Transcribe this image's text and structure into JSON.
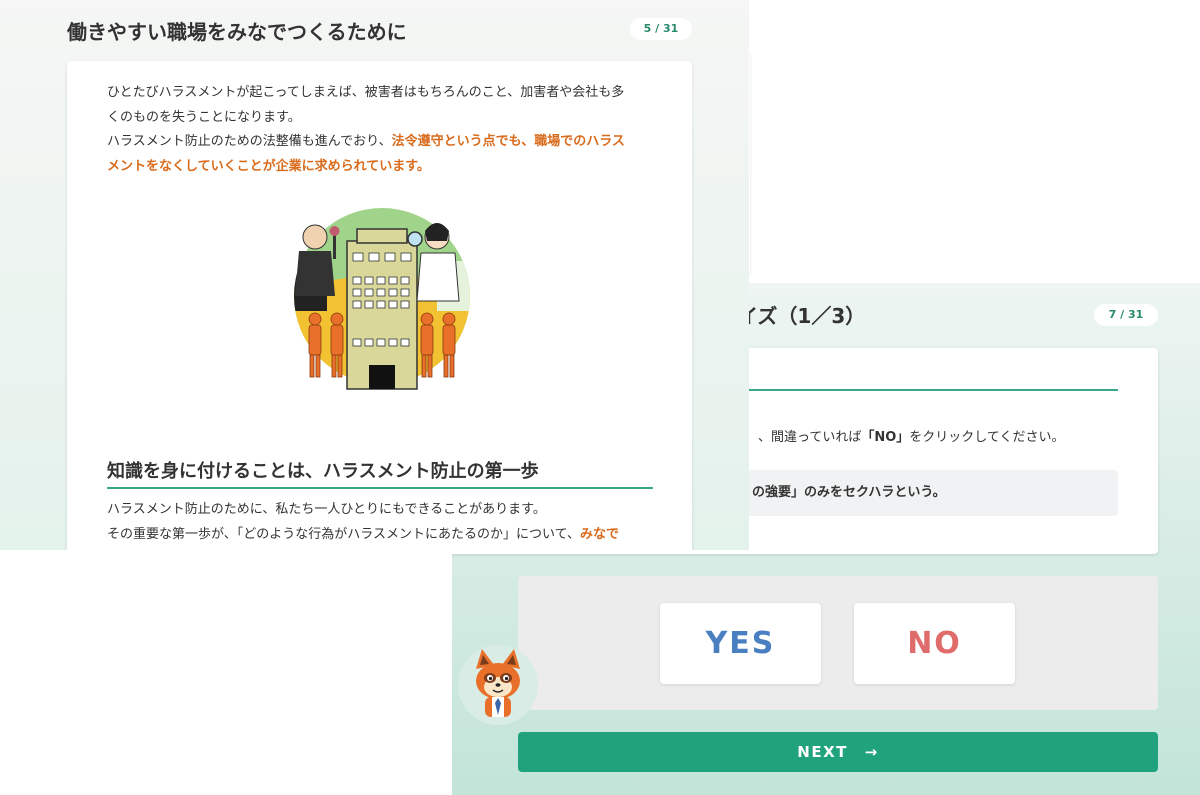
{
  "lesson": {
    "title": "働きやすい職場をみなでつくるために",
    "page": "5 / 31",
    "para1_line1": "ひとたびハラスメントが起こってしまえば、被害者はもちろんのこと、加害者や会社も多",
    "para1_line2": "くのものを失うことになります。",
    "para2_plain": "ハラスメント防止のための法整備も進んでおり、",
    "para2_highlight_a": "法令遵守という点でも、職場でのハラス",
    "para2_highlight_b": "メントをなくしていくことが企業に求められています。",
    "section_title": "知識を身に付けることは、ハラスメント防止の第一歩",
    "para3_line1": "ハラスメント防止のために、私たち一人ひとりにもできることがあります。",
    "para3_line2_plain": "その重要な第一歩が、「どのような行為がハラスメントにあたるのか」について、",
    "para3_line2_highlight": "みなで"
  },
  "quiz": {
    "title_partial": "イズ（1／3）",
    "page": "7 / 31",
    "instruction_a": "、間違っていれば",
    "instruction_no": "「NO」",
    "instruction_b": "をクリックしてください。",
    "statement_partial": "の強要」のみをセクハラという。",
    "yes_label": "YES",
    "no_label": "NO",
    "next_label": "NEXT",
    "next_arrow": "→"
  },
  "colors": {
    "accent_green": "#20a27d",
    "highlight_orange": "#d96b1c",
    "yes_blue": "#4a7fc1",
    "no_red": "#e06b6b"
  }
}
